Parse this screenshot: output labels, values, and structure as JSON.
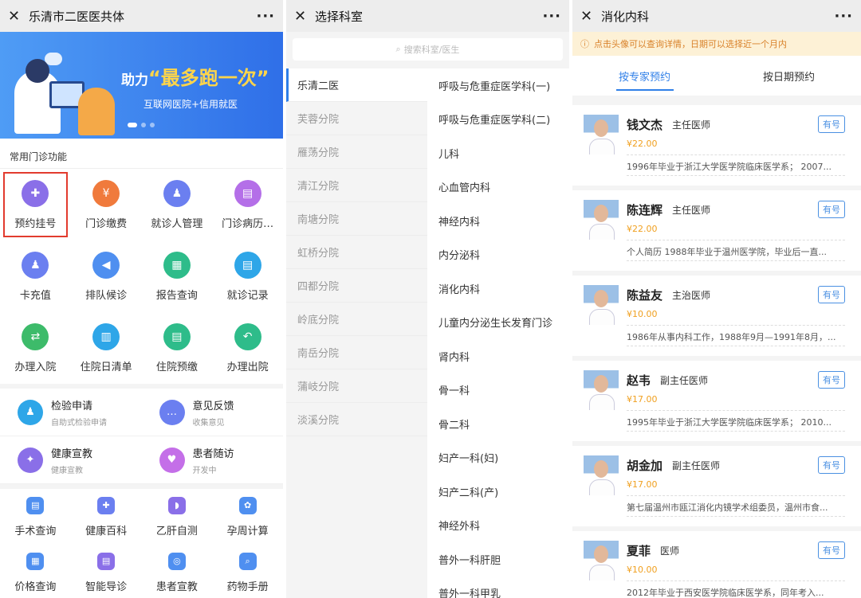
{
  "p1": {
    "title": "乐清市二医医共体",
    "banner": {
      "pre": "助力",
      "quote": "“最多跑一次”",
      "sub": "互联网医院+信用就医"
    },
    "section": "常用门诊功能",
    "grid": [
      {
        "label": "预约挂号",
        "icon": "plus-cross-icon",
        "color": "#8a6fe8",
        "g": "✚"
      },
      {
        "label": "门诊缴费",
        "icon": "wallet-icon",
        "color": "#f07a3c",
        "g": "¥"
      },
      {
        "label": "就诊人管理",
        "icon": "user-manage-icon",
        "color": "#6b7ff0",
        "g": "♟"
      },
      {
        "label": "门诊病历…",
        "icon": "record-book-icon",
        "color": "#b46fe8",
        "g": "▤"
      },
      {
        "label": "卡充值",
        "icon": "card-recharge-icon",
        "color": "#6b7ff0",
        "g": "♟"
      },
      {
        "label": "排队候诊",
        "icon": "queue-speaker-icon",
        "color": "#4f8ff0",
        "g": "◀"
      },
      {
        "label": "报告查询",
        "icon": "report-icon",
        "color": "#2ebc8a",
        "g": "▦"
      },
      {
        "label": "就诊记录",
        "icon": "clipboard-icon",
        "color": "#2ea6e8",
        "g": "▤"
      },
      {
        "label": "办理入院",
        "icon": "admission-icon",
        "color": "#3dbb6a",
        "g": "⇄"
      },
      {
        "label": "住院日清单",
        "icon": "daily-list-icon",
        "color": "#2ea6e8",
        "g": "▥"
      },
      {
        "label": "住院预缴",
        "icon": "prepay-icon",
        "color": "#2ebc8a",
        "g": "▤"
      },
      {
        "label": "办理出院",
        "icon": "discharge-icon",
        "color": "#2ebc8a",
        "g": "↶"
      }
    ],
    "twos": [
      {
        "title": "检验申请",
        "sub": "自助式检验申请",
        "icon": "lab-request-icon",
        "color": "#2ea6e8",
        "g": "♟"
      },
      {
        "title": "意见反馈",
        "sub": "收集意见",
        "icon": "feedback-icon",
        "color": "#6b7ff0",
        "g": "…"
      },
      {
        "title": "健康宣教",
        "sub": "健康宣教",
        "icon": "health-edu-icon",
        "color": "#8a6fe8",
        "g": "✦"
      },
      {
        "title": "患者随访",
        "sub": "开发中",
        "icon": "follow-up-icon",
        "color": "#c46fe8",
        "g": "♥"
      }
    ],
    "smalls": [
      {
        "label": "手术查询",
        "icon": "surgery-icon",
        "color": "#4f8ff0",
        "g": "▤"
      },
      {
        "label": "健康百科",
        "icon": "encyclopedia-icon",
        "color": "#6b7ff0",
        "g": "✚"
      },
      {
        "label": "乙肝自测",
        "icon": "liver-test-icon",
        "color": "#8a6fe8",
        "g": "◗"
      },
      {
        "label": "孕周计算",
        "icon": "pregnancy-icon",
        "color": "#4f8ff0",
        "g": "✿"
      },
      {
        "label": "价格查询",
        "icon": "calculator-icon",
        "color": "#4f8ff0",
        "g": "▦"
      },
      {
        "label": "智能导诊",
        "icon": "guide-icon",
        "color": "#8a6fe8",
        "g": "▤"
      },
      {
        "label": "患者宣教",
        "icon": "compass-icon",
        "color": "#4f8ff0",
        "g": "◎"
      },
      {
        "label": "药物手册",
        "icon": "drug-manual-icon",
        "color": "#4f8ff0",
        "g": "⌕"
      }
    ]
  },
  "p2": {
    "title": "选择科室",
    "search_placeholder": "搜索科室/医生",
    "hospitals": [
      "乐清二医",
      "芙蓉分院",
      "雁荡分院",
      "清江分院",
      "南塘分院",
      "虹桥分院",
      "四都分院",
      "岭底分院",
      "南岳分院",
      "蒲岐分院",
      "淡溪分院"
    ],
    "departments": [
      "呼吸与危重症医学科(一)",
      "呼吸与危重症医学科(二)",
      "儿科",
      "心血管内科",
      "神经内科",
      "内分泌科",
      "消化内科",
      "儿童内分泌生长发育门诊",
      "肾内科",
      "骨一科",
      "骨二科",
      "妇产一科(妇)",
      "妇产二科(产)",
      "神经外科",
      "普外一科肝胆",
      "普外一科甲乳"
    ]
  },
  "p3": {
    "title": "消化内科",
    "notice": "点击头像可以查询详情，日期可以选择近一个月内",
    "tabs": [
      "按专家预约",
      "按日期预约"
    ],
    "doctors": [
      {
        "name": "钱文杰",
        "title": "主任医师",
        "price": "¥22.00",
        "desc": "1996年毕业于浙江大学医学院临床医学系； 2007...",
        "badge": "有号"
      },
      {
        "name": "陈连辉",
        "title": "主任医师",
        "price": "¥22.00",
        "desc": "个人简历 1988年毕业于温州医学院，毕业后一直...",
        "badge": "有号"
      },
      {
        "name": "陈益友",
        "title": "主治医师",
        "price": "¥10.00",
        "desc": "1986年从事内科工作，1988年9月—1991年8月，...",
        "badge": "有号"
      },
      {
        "name": "赵韦",
        "title": "副主任医师",
        "price": "¥17.00",
        "desc": "1995年毕业于浙江大学医学院临床医学系； 2010...",
        "badge": "有号"
      },
      {
        "name": "胡金加",
        "title": "副主任医师",
        "price": "¥17.00",
        "desc": "第七届温州市瓯江消化内镜学术组委员，温州市食...",
        "badge": "有号"
      },
      {
        "name": "夏菲",
        "title": "医师",
        "price": "¥10.00",
        "desc": "2012年毕业于西安医学院临床医学系，同年考入...",
        "badge": "有号"
      }
    ]
  }
}
